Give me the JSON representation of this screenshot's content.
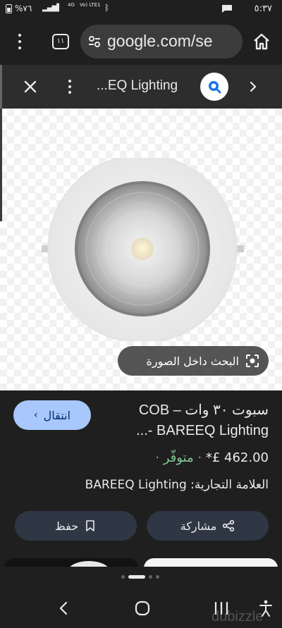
{
  "status_bar": {
    "time": "٥:٣٧",
    "battery_pct": "%٧٦",
    "network": "4G",
    "lte": "Vo) LTE1"
  },
  "browser": {
    "tab_count": "١١",
    "url": "google.com/se"
  },
  "lens": {
    "title": "...EQ Lighting"
  },
  "image": {
    "search_inside_label": "البحث داخل الصورة"
  },
  "product": {
    "title_line1": "سبوت ٣٠ وات – COB",
    "title_line2": "BAREEQ Lighting -...",
    "goto_label": "انتقال",
    "price": "462.00 £*",
    "separator": "·",
    "availability": "متوفّر",
    "brand": "العلامة التجارية: BAREEQ Lighting",
    "share_label": "مشاركة",
    "save_label": "حفظ"
  },
  "watermark": "dubizzle",
  "colors": {
    "goto_button_bg": "#a8c7fa",
    "availability_green": "#81c995",
    "action_button_bg": "#2f3744"
  }
}
